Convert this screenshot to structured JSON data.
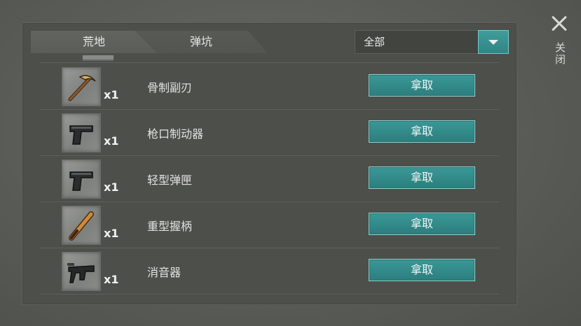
{
  "tabs": [
    {
      "label": "荒地"
    },
    {
      "label": "弹坑"
    }
  ],
  "filter": {
    "selected": "全部"
  },
  "close": {
    "label": "关闭"
  },
  "items": [
    {
      "name": "骨制副刃",
      "qty": "x1",
      "icon": "pickaxe-icon",
      "action": "拿取"
    },
    {
      "name": "枪口制动器",
      "qty": "x1",
      "icon": "pistol-icon",
      "action": "拿取"
    },
    {
      "name": "轻型弹匣",
      "qty": "x1",
      "icon": "pistol-icon",
      "action": "拿取"
    },
    {
      "name": "重型握柄",
      "qty": "x1",
      "icon": "bat-icon",
      "action": "拿取"
    },
    {
      "name": "消音器",
      "qty": "x1",
      "icon": "smg-icon",
      "action": "拿取"
    }
  ],
  "colors": {
    "accent": "#2f8584",
    "panel": "#4d4f4b",
    "background": "#5a5c58"
  }
}
